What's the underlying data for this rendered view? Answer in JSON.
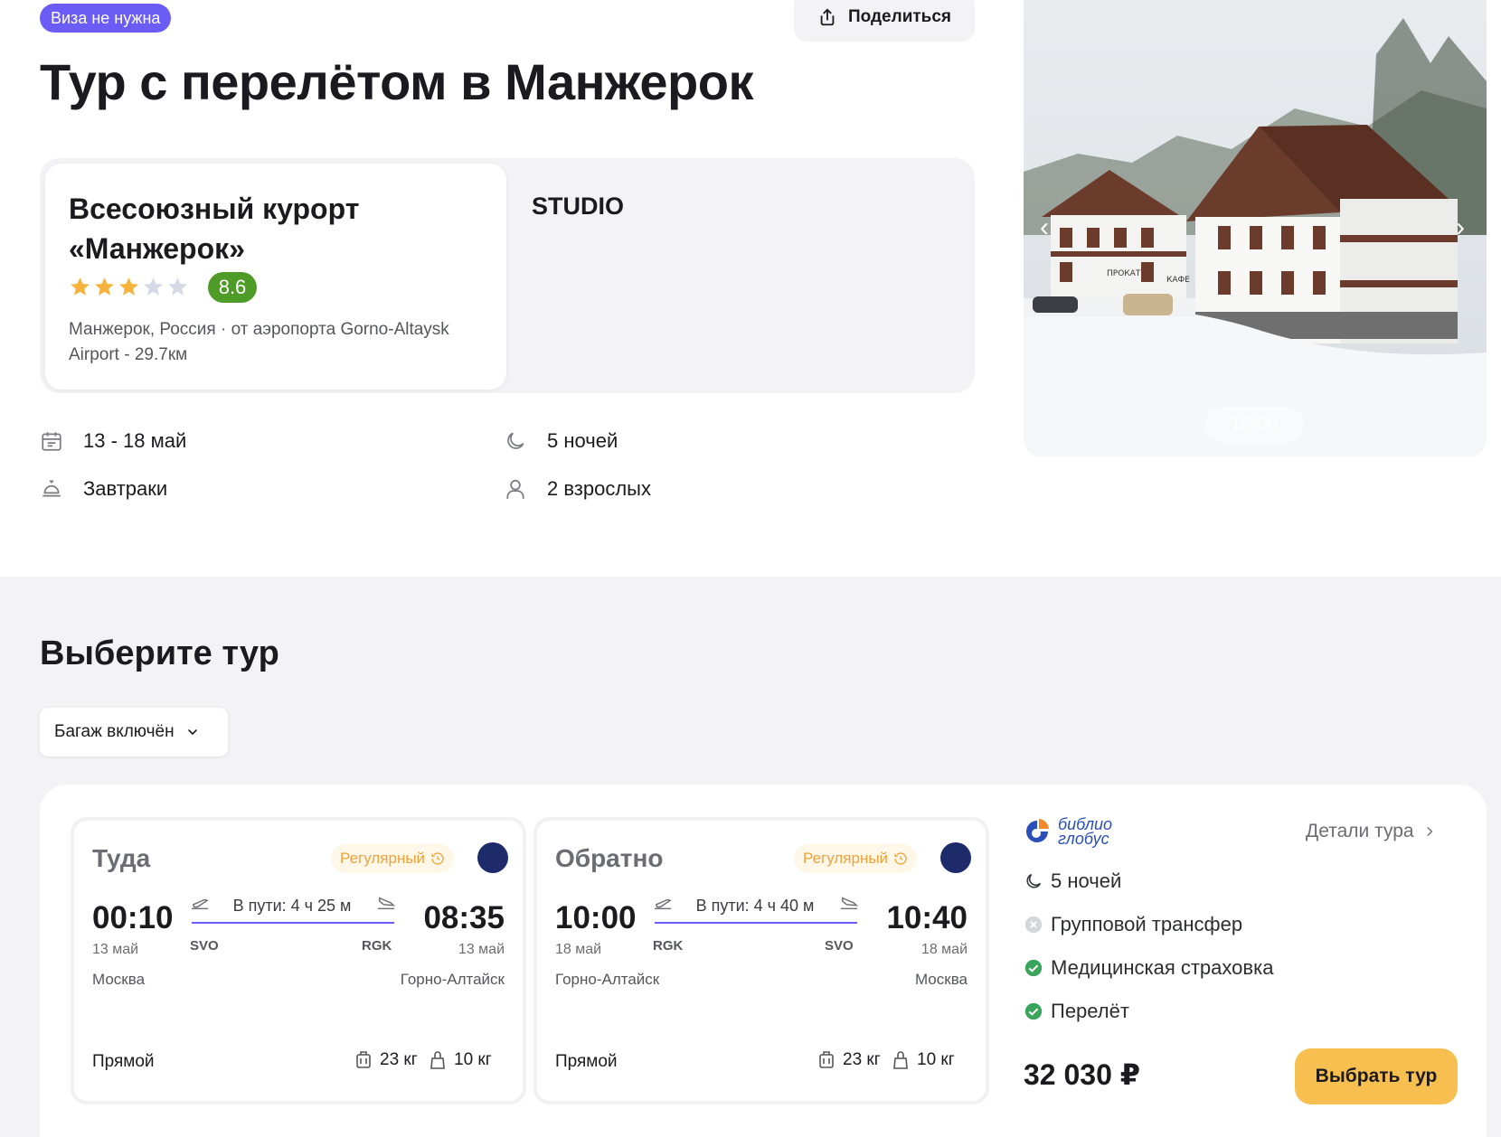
{
  "header": {
    "visa_badge": "Виза не нужна",
    "share_label": "Поделиться",
    "title": "Тур с перелётом в Манжерок"
  },
  "hotel": {
    "name": "Всесоюзный курорт «Манжерок»",
    "stars": 3,
    "max_stars": 5,
    "rating": "8.6",
    "location": "Манжерок, Россия · от аэропорта Gorno-Altaysk Airport - 29.7км",
    "room": "STUDIO"
  },
  "trip": {
    "dates": "13 - 18 май",
    "nights": "5 ночей",
    "meals": "Завтраки",
    "guests": "2 взрослых"
  },
  "photo": {
    "counter": "1/200",
    "signs": [
      "ПРОКАТ",
      "КАФЕ"
    ]
  },
  "tours": {
    "section_title": "Выберите тур",
    "filter_label": "Багаж включён",
    "outbound": {
      "direction": "Туда",
      "type": "Регулярный",
      "dep_time": "00:10",
      "dep_date": "13 май",
      "dep_city": "Москва",
      "dep_code": "SVO",
      "duration": "В пути: 4 ч 25 м",
      "arr_time": "08:35",
      "arr_date": "13 май",
      "arr_city": "Горно-Алтайск",
      "arr_code": "RGK",
      "kind": "Прямой",
      "bag_checked": "23 кг",
      "bag_hand": "10 кг"
    },
    "return": {
      "direction": "Обратно",
      "type": "Регулярный",
      "dep_time": "10:00",
      "dep_date": "18 май",
      "dep_city": "Горно-Алтайск",
      "dep_code": "RGK",
      "duration": "В пути: 4 ч 40 м",
      "arr_time": "10:40",
      "arr_date": "18 май",
      "arr_city": "Москва",
      "arr_code": "SVO",
      "kind": "Прямой",
      "bag_checked": "23 кг",
      "bag_hand": "10 кг"
    },
    "operator": {
      "logo_line1": "библио",
      "logo_line2": "глобус",
      "details_label": "Детали тура"
    },
    "features": [
      {
        "label": "5 ночей",
        "icon": "moon-icon"
      },
      {
        "label": "Групповой трансфер",
        "icon": "cross-circle-icon",
        "included": false
      },
      {
        "label": "Медицинская страховка",
        "icon": "check-circle-icon",
        "included": true
      },
      {
        "label": "Перелёт",
        "icon": "check-circle-icon",
        "included": true
      }
    ],
    "price": "32 030 ₽",
    "select_label": "Выбрать тур"
  },
  "colors": {
    "accent": "#6a5cf4",
    "rating": "#4f9b28",
    "star": "#f6b23c",
    "cta": "#f6bf4f",
    "check": "#3aa55c"
  }
}
